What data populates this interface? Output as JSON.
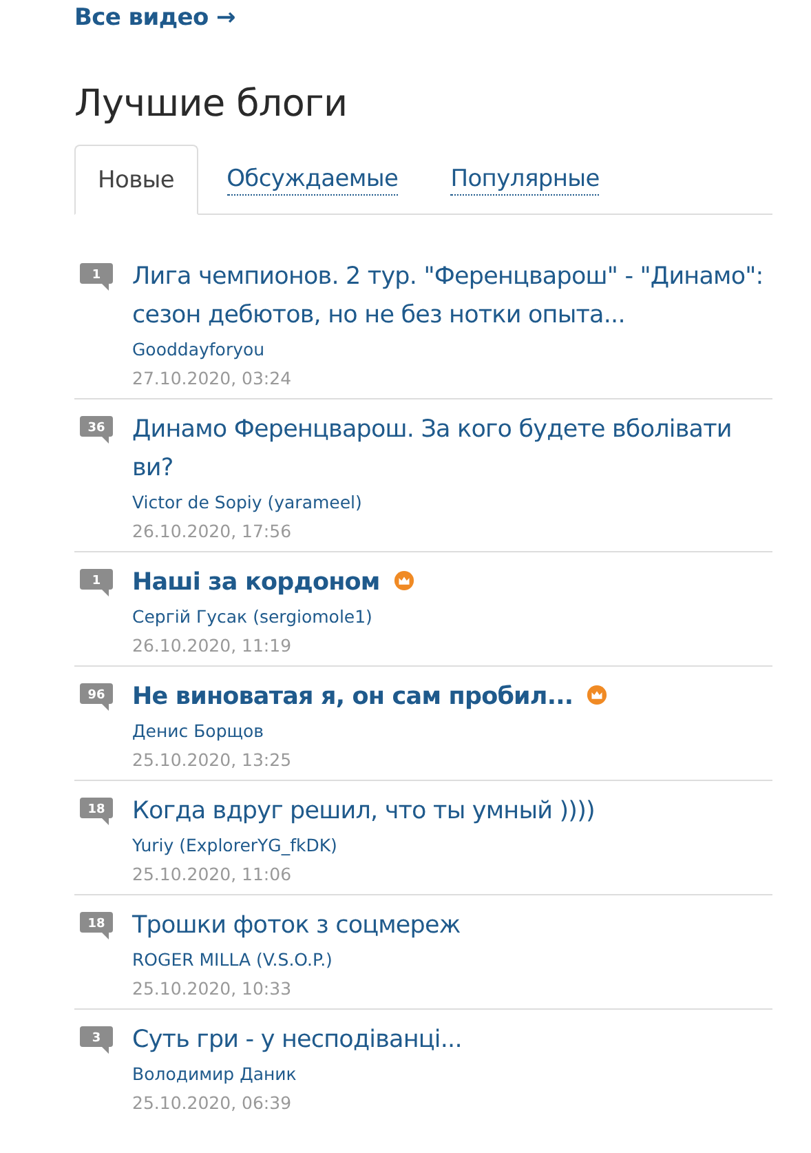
{
  "all_videos_link": "Все видео →",
  "heading": "Лучшие блоги",
  "tabs": [
    {
      "label": "Новые",
      "selected": true
    },
    {
      "label": "Обсуждаемые",
      "selected": false
    },
    {
      "label": "Популярные",
      "selected": false
    }
  ],
  "posts": [
    {
      "comments": "1",
      "title": "Лига чемпионов. 2 тур. \"Ференцварош\" - \"Динамо\": сезон дебютов, но не без нотки опыта...",
      "author": "Gooddayforyou",
      "date": "27.10.2020, 03:24",
      "featured": false
    },
    {
      "comments": "36",
      "title": "Динамо Ференцварош. За кого будете вболівати ви?",
      "author": "Victor de Sopiy (yarameel)",
      "date": "26.10.2020, 17:56",
      "featured": false
    },
    {
      "comments": "1",
      "title": "Наші за кордоном",
      "author": "Сергій Гусак (sergiomole1)",
      "date": "26.10.2020, 11:19",
      "featured": true
    },
    {
      "comments": "96",
      "title": "Не виноватая я, он сам пробил...",
      "author": "Денис Борщов",
      "date": "25.10.2020, 13:25",
      "featured": true
    },
    {
      "comments": "18",
      "title": "Когда вдруг решил, что ты умный ))))",
      "author": "Yuriy (ExplorerYG_fkDK)",
      "date": "25.10.2020, 11:06",
      "featured": false
    },
    {
      "comments": "18",
      "title": "Трошки фоток з соцмереж",
      "author": "ROGER MILLA (V.S.O.P.)",
      "date": "25.10.2020, 10:33",
      "featured": false
    },
    {
      "comments": "3",
      "title": "Суть гри - у несподіванці...",
      "author": "Володимир Даник",
      "date": "25.10.2020, 06:39",
      "featured": false
    }
  ]
}
